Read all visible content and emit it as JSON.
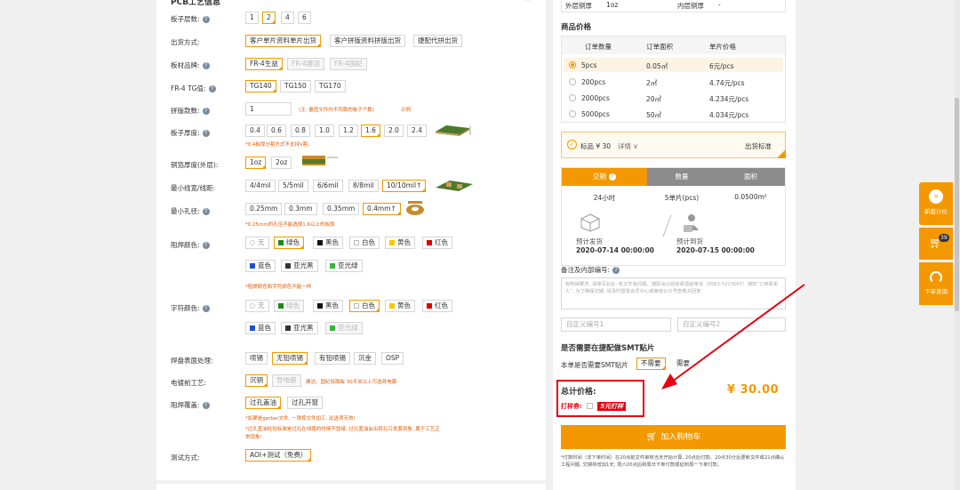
{
  "left": {
    "section_title": "PCB工艺信息",
    "layers": {
      "label": "板子层数:",
      "options": [
        "1",
        "2",
        "4",
        "6"
      ]
    },
    "shipping": {
      "label": "出货方式:",
      "options": [
        "客户单片资料单片出货",
        "客户拼版资料拼版出货",
        "捷配代拼出货"
      ]
    },
    "material": {
      "label": "板材品牌:",
      "options": [
        "FR-4生益",
        "FR-4建滔",
        "FR-4国纪"
      ]
    },
    "tg": {
      "label": "FR-4 TG值:",
      "options": [
        "TG140",
        "TG150",
        "TG170"
      ]
    },
    "panel_count": {
      "label": "拼版款数:",
      "value": "1",
      "note": "(注: 量值文件内不同款的板子个数)",
      "example": "示例"
    },
    "thickness": {
      "label": "板子厚度:",
      "options": [
        "0.4",
        "0.6",
        "0.8",
        "1.0",
        "1.2",
        "1.6",
        "2.0",
        "2.4"
      ],
      "note": "*0.4板厚分割方式不支持V割。"
    },
    "copper": {
      "label": "铜箔厚度(外层):",
      "options": [
        "1oz",
        "2oz"
      ]
    },
    "trace": {
      "label": "最小线宽/线距:",
      "options": [
        "4/4mil",
        "5/5mil",
        "6/6mil",
        "8/8mil",
        "10/10mil↑"
      ]
    },
    "hole": {
      "label": "最小孔径:",
      "options": [
        "0.25mm",
        "0.3mm",
        "0.35mm",
        "0.4mm↑"
      ],
      "note": "*0.25mm的孔径不能选择1.6以上的板厚"
    },
    "mask": {
      "label": "阻焊颜色:",
      "row1": [
        "无",
        "绿色",
        "黑色",
        "白色",
        "黄色",
        "红色"
      ],
      "row2": [
        "蓝色",
        "亚光黑",
        "亚光绿"
      ],
      "note": "*阻焊颜色和字符颜色不能一样"
    },
    "silk": {
      "label": "字符颜色:",
      "row1": [
        "无",
        "绿色",
        "黑色",
        "白色",
        "黄色",
        "红色"
      ],
      "row2": [
        "蓝色",
        "亚光黑",
        "亚光绿"
      ]
    },
    "surface": {
      "label": "焊盘表面处理:",
      "options": [
        "喷锡",
        "无铅喷锡",
        "有铅喷锡",
        "沉金",
        "OSP"
      ]
    },
    "plating": {
      "label": "电镀前工艺:",
      "options": [
        "沉铜",
        "导电膜"
      ],
      "note": "建滔、国纪双面板 30平米以上可选导电膜"
    },
    "via": {
      "label": "阻焊覆盖:",
      "options": [
        "过孔盖油",
        "过孔开窗"
      ],
      "note1": "*如果是gerber文件, 一律按文件加工, 此选项无效!",
      "note2": "*过孔盖油检验标准是过孔在线路的时候不冒绿, 过孔盖油会出现孔口发黄现象, 属于工艺正",
      "note3": "常现象!"
    },
    "test": {
      "label": "测试方式:",
      "options": [
        "AOI+测试（免费）"
      ]
    }
  },
  "right": {
    "copper_row": {
      "outer_label": "外层铜厚",
      "outer_value": "1oz",
      "inner_label": "内层铜厚",
      "inner_value": "-"
    },
    "price_title": "商品价格",
    "price_headers": [
      "订单数量",
      "订单面积",
      "单片价格"
    ],
    "price_rows": [
      {
        "qty": "5pcs",
        "area": "0.05㎡",
        "price": "6元/pcs",
        "selected": true
      },
      {
        "qty": "200pcs",
        "area": "2㎡",
        "price": "4.74元/pcs",
        "selected": false
      },
      {
        "qty": "2000pcs",
        "area": "20㎡",
        "price": "4.234元/pcs",
        "selected": false
      },
      {
        "qty": "5000pcs",
        "area": "50㎡",
        "price": "4.034元/pcs",
        "selected": false
      }
    ],
    "badge": {
      "text": "标品 ¥ 30",
      "detail": "详情",
      "shipping_std": "出货标准"
    },
    "delivery_headers": [
      "交期",
      "数量",
      "面积"
    ],
    "delivery_values": [
      "24小时",
      "5单片(pcs)",
      "0.0500m²"
    ],
    "ship_label": "预计发货",
    "ship_date": "2020-07-14 00:00:00",
    "arrive_label": "预计到货",
    "arrive_date": "2020-07-15 00:00:00",
    "remark_label": "备注及内部编号:",
    "remark_placeholder": "有特殊要求, 请填写此处: 有文件有问题、捷配会以经信或语音电话（0563-5223007）通知“订单联系人”, 为了确保交期, 请及时登录会员中心或微信公众号查看并回复",
    "custom1": "自定义编号1",
    "custom2": "自定义编号2",
    "smt_title": "是否需要在捷配做SMT贴片",
    "smt_label": "本单是否需要SMT贴片",
    "smt_options": [
      "不需要",
      "需要"
    ],
    "total_label": "总计价格:",
    "total_value": "¥ 30.00",
    "coupon_label": "打样券:",
    "coupon_text": "5元打样",
    "cart_button": "加入购物车",
    "footnote": "*付款时间（非下单时间）在20点前文件审核当天开始计算, 20点后付款、20点30分后更新文件或21点确认工程问题, 交期将增加1天; 周六20点后和周日下单付款顺延到周一下单付款。"
  },
  "float": {
    "new_quote": "新版计价",
    "cart_count": "39",
    "consult": "下单咨询"
  },
  "colors": {
    "accent": "#f39800",
    "red": "#e60012",
    "blue_header": "#f7f7f7"
  }
}
